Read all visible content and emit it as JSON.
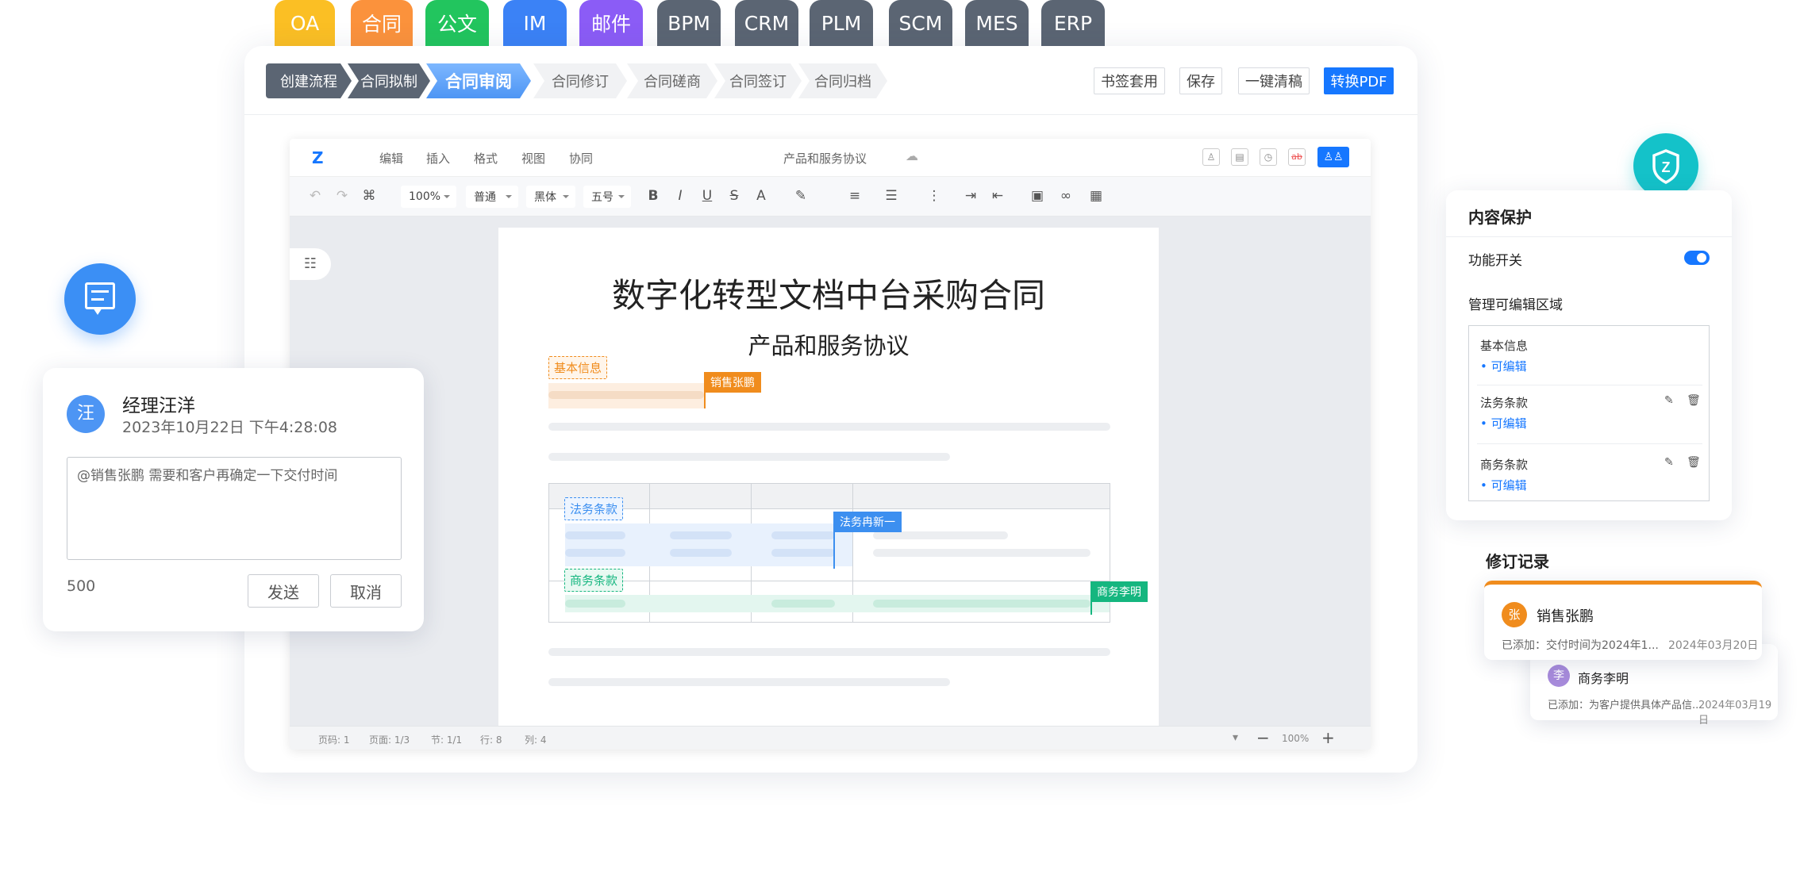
{
  "app_tabs": [
    {
      "label": "OA",
      "color": "#fbbf24"
    },
    {
      "label": "合同",
      "color": "#fb923c"
    },
    {
      "label": "公文",
      "color": "#22c55e"
    },
    {
      "label": "IM",
      "color": "#3b82f6"
    },
    {
      "label": "邮件",
      "color": "#8b5cf6"
    },
    {
      "label": "BPM",
      "color": "#5b6573"
    },
    {
      "label": "CRM",
      "color": "#5b6573"
    },
    {
      "label": "PLM",
      "color": "#5b6573"
    },
    {
      "label": "SCM",
      "color": "#5b6573"
    },
    {
      "label": "MES",
      "color": "#5b6573"
    },
    {
      "label": "ERP",
      "color": "#5b6573"
    }
  ],
  "workflow": {
    "steps": [
      "创建流程",
      "合同拟制",
      "合同审阅",
      "合同修订",
      "合同磋商",
      "合同签订",
      "合同归档"
    ],
    "active_step": "合同审阅"
  },
  "actions": {
    "bookmark": "书签套用",
    "save": "保存",
    "clean": "一键清稿",
    "convert_pdf": "转换PDF"
  },
  "editor": {
    "logo": "Z",
    "menus": [
      "编辑",
      "插入",
      "格式",
      "视图",
      "协同"
    ],
    "doc_title": "产品和服务协议",
    "toolbar": {
      "zoom": "100%",
      "style": "普通",
      "font": "黑体",
      "size": "五号"
    },
    "status": {
      "page_code": "页码: 1",
      "page": "页面: 1/3",
      "section": "节: 1/1",
      "line": "行: 8",
      "column": "列: 4",
      "zoom": "100%"
    },
    "document": {
      "title": "数字化转型文档中台采购合同",
      "subtitle": "产品和服务协议",
      "tag_basic": "基本信息",
      "tag_legal": "法务条款",
      "tag_business": "商务条款",
      "flag_sales": "销售张鹏",
      "flag_legal": "法务冉新一",
      "flag_business": "商务李明"
    }
  },
  "comment": {
    "avatar": "汪",
    "author": "经理汪洋",
    "time": "2023年10月22日 下午4:28:08",
    "text": "@销售张鹏 需要和客户再确定一下交付时间",
    "counter": "500",
    "send": "发送",
    "cancel": "取消"
  },
  "protection": {
    "title": "内容保护",
    "toggle_label": "功能开关",
    "toggle_on": true,
    "manage_label": "管理可编辑区域",
    "regions": [
      {
        "name": "基本信息",
        "status": "• 可编辑"
      },
      {
        "name": "法务条款",
        "status": "• 可编辑"
      },
      {
        "name": "商务条款",
        "status": "• 可编辑"
      }
    ],
    "accent": "#1677ff",
    "shield_color": "#14c2c9"
  },
  "revisions": {
    "title": "修订记录",
    "items": [
      {
        "avatar": "张",
        "name": "销售张鹏",
        "detail": "已添加：交付时间为2024年1...",
        "date": "2024年03月20日",
        "color": "#f08c1d"
      },
      {
        "avatar": "李",
        "name": "商务李明",
        "detail": "已添加：为客户提供具体产品信...",
        "date": "2024年03月19日",
        "color": "#a78bdb"
      }
    ]
  }
}
